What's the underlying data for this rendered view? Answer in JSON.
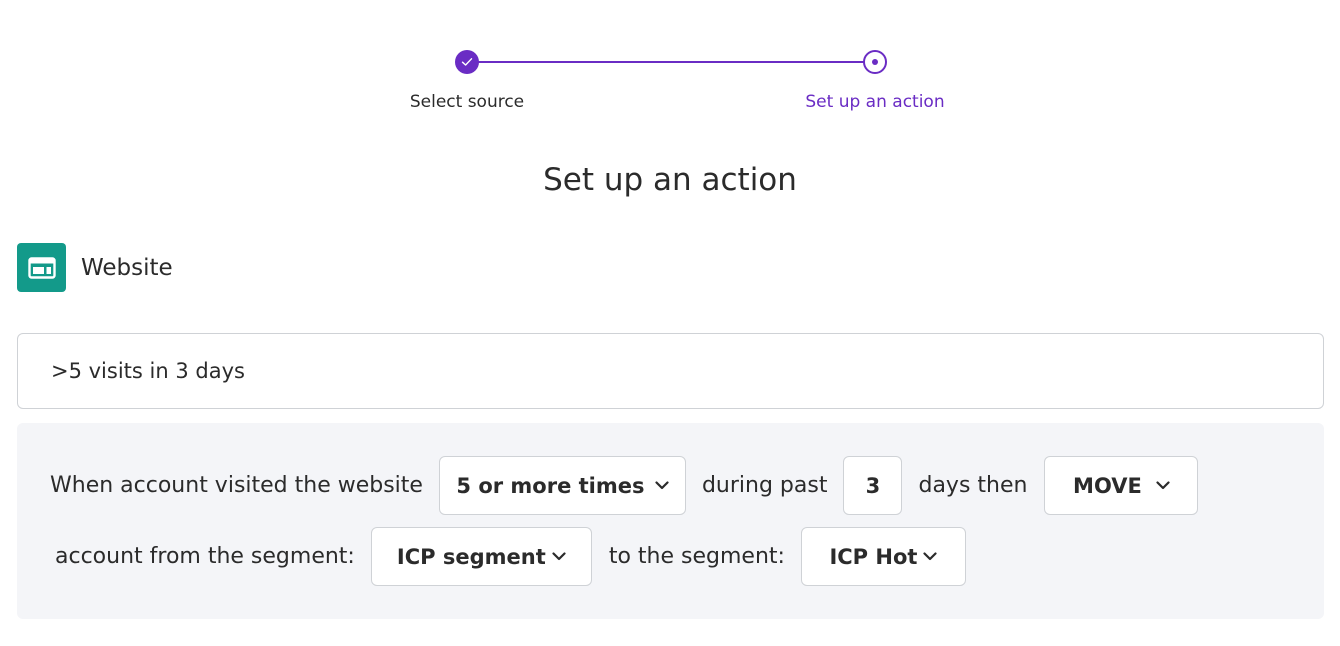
{
  "stepper": {
    "steps": [
      {
        "label": "Select source",
        "state": "completed"
      },
      {
        "label": "Set up an action",
        "state": "current"
      }
    ],
    "accent_color": "#6a2cc4"
  },
  "page_title": "Set up an action",
  "source": {
    "label": "Website",
    "icon": "website-icon",
    "icon_color": "#139a8a"
  },
  "action_name": {
    "value": ">5 visits in 3 days"
  },
  "rule": {
    "text_when": "When account visited the website",
    "visits_select": "5 or more times",
    "text_during": "during past",
    "days_value": "3",
    "text_days_then": "days then",
    "action_select": "MOVE",
    "text_from": "account from the segment:",
    "from_segment_select": "ICP segment",
    "text_to": "to the segment:",
    "to_segment_select": "ICP Hot"
  }
}
